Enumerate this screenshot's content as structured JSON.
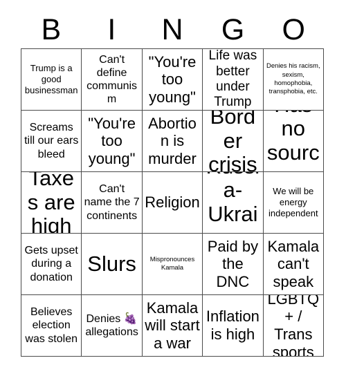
{
  "card": {
    "header_letters": [
      "B",
      "I",
      "N",
      "G",
      "O"
    ],
    "grid": {
      "rows": 5,
      "columns": 5,
      "border_color": "#4a4a4a",
      "background_color": "#ffffff",
      "text_color": "#000000"
    },
    "cells": [
      {
        "text": "Trump is a good businessman",
        "size": "sm"
      },
      {
        "text": "Can't define communism",
        "size": "md"
      },
      {
        "text": "\"You're too young\"",
        "size": "xl"
      },
      {
        "text": "Life was better under Trump",
        "size": "lg"
      },
      {
        "text": "Denies his racism, sexism, homophobia, transphobia, etc.",
        "size": "xxs"
      },
      {
        "text": "Screams till our ears bleed",
        "size": "md"
      },
      {
        "text": "\"You're too young\"",
        "size": "xl"
      },
      {
        "text": "Abortion is murder",
        "size": "xl"
      },
      {
        "text": "Border crisis",
        "size": "xxl"
      },
      {
        "text": "Has no sources",
        "size": "xxl"
      },
      {
        "text": "Taxes are high",
        "size": "xxl"
      },
      {
        "text": "Can't name the 7 continents",
        "size": "md"
      },
      {
        "text": "Religion",
        "size": "xl"
      },
      {
        "text": "Russia-Ukraine",
        "size": "xxl"
      },
      {
        "text": "We will be energy independent",
        "size": "sm"
      },
      {
        "text": "Gets upset during a donation",
        "size": "md"
      },
      {
        "text": "Slurs",
        "size": "xxl"
      },
      {
        "text": "Mispronounces Kamala",
        "size": "xxs"
      },
      {
        "text": "Paid by the DNC",
        "size": "xl"
      },
      {
        "text": "Kamala can't speak",
        "size": "xl"
      },
      {
        "text": "Believes election was stolen",
        "size": "md"
      },
      {
        "text": "Denies 🍇 allegations",
        "size": "md"
      },
      {
        "text": "Kamala will start a war",
        "size": "xl"
      },
      {
        "text": "Inflation is high",
        "size": "xl"
      },
      {
        "text": "LGBTQ+ / Trans sports",
        "size": "xl"
      }
    ]
  }
}
